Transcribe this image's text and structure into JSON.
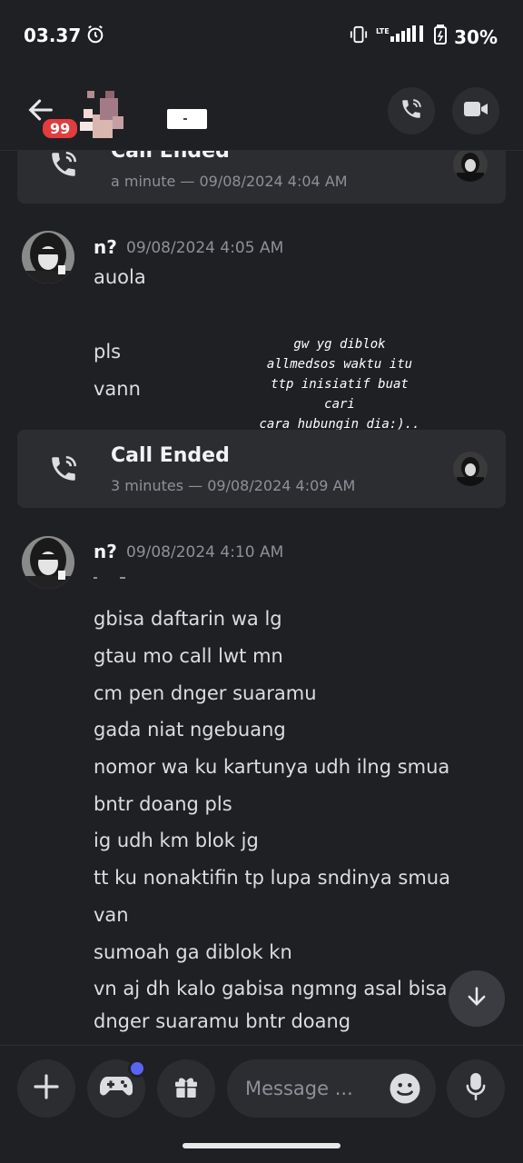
{
  "status_bar": {
    "time": "03.37",
    "alarm_icon": "alarm-clock-icon",
    "network": "LTE",
    "battery": "30%"
  },
  "header": {
    "back_icon": "arrow-left-icon",
    "unread_badge": "99",
    "call_icon": "phone-icon",
    "video_icon": "video-camera-icon"
  },
  "messages": {
    "call_top": {
      "title": "Call Ended",
      "meta": "a minute — 09/08/2024 4:04 AM"
    },
    "group1": {
      "author": "n?",
      "timestamp": "09/08/2024 4:05 AM",
      "lines": [
        "auola",
        "pls",
        "vann"
      ]
    },
    "annotation": [
      "gw yg diblok",
      "allmedsos waktu itu",
      "ttp inisiatif buat cari",
      "cara hubungin dia:).."
    ],
    "call_mid": {
      "title": "Call Ended",
      "meta": "3 minutes — 09/08/2024 4:09 AM"
    },
    "group2": {
      "author": "n?",
      "timestamp": "09/08/2024 4:10 AM",
      "lines": [
        "gbisa daftarin wa lg",
        "gtau mo call lwt mn",
        "cm pen dnger suaramu",
        "gada niat ngebuang",
        "nomor wa ku kartunya udh ilng smua",
        "bntr doang pls",
        "ig udh km blok jg",
        "tt ku nonaktifin tp lupa sndinya smua",
        "van",
        "sumoah ga diblok kn",
        "vn aj dh kalo gabisa ngmng asal bisa",
        "dnger suaramu bntr doang"
      ]
    }
  },
  "composer": {
    "placeholder": "Message ...",
    "plus_icon": "plus-icon",
    "game_icon": "gamepad-icon",
    "gift_icon": "gift-icon",
    "emoji_icon": "emoji-icon",
    "mic_icon": "microphone-icon"
  },
  "colors": {
    "background": "#1f2024",
    "card": "#2b2d31",
    "badge": "#e23c3f",
    "accent": "#5865f2",
    "muted": "#8e9098"
  }
}
